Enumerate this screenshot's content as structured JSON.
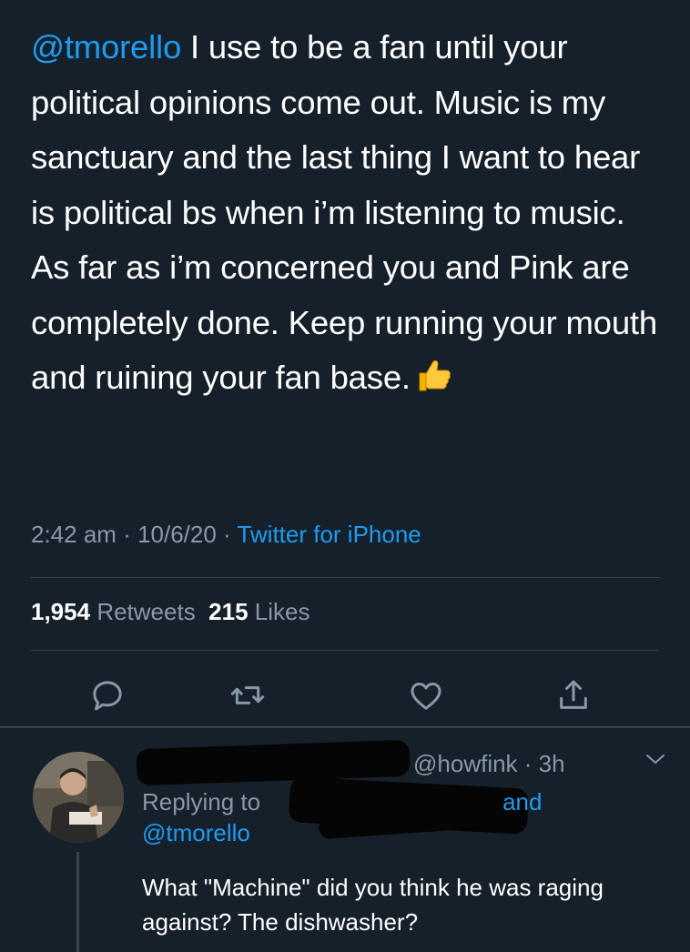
{
  "tweet": {
    "mention": "@tmorello",
    "text": " I use to be a fan until your political opinions come out. Music is my sanctuary and the last thing I want to hear is political bs when i’m listening to music. As far as i’m concerned you and Pink are completely done. Keep running your mouth and ruining your fan base.",
    "emoji": "thumbs-up",
    "time": "2:42 am",
    "date": "10/6/20",
    "separator": " · ",
    "source": "Twitter for iPhone"
  },
  "stats": {
    "retweets_count": "1,954",
    "retweets_label": "Retweets",
    "likes_count": "215",
    "likes_label": "Likes"
  },
  "actions": {
    "reply_icon": "reply-icon",
    "retweet_icon": "retweet-icon",
    "like_icon": "heart-icon",
    "share_icon": "share-icon"
  },
  "reply": {
    "handle_visible": "@howfink",
    "time": "3h",
    "replying_prefix": "Replying to",
    "and": "and",
    "mention": "@tmorello",
    "text": "What \"Machine\" did you think he was raging against? The dishwasher?"
  },
  "colors": {
    "background": "#15202b",
    "text": "#ffffff",
    "secondary": "#8899a6",
    "accent": "#1d9bf0",
    "divider": "#38444d"
  }
}
